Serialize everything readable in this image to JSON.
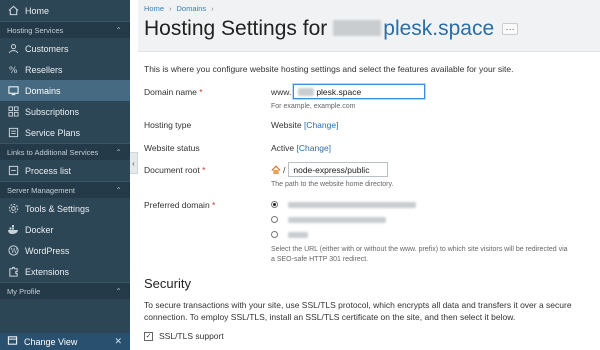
{
  "sidebar": {
    "home": "Home",
    "sections": {
      "hosting": "Hosting Services",
      "links": "Links to Additional Services",
      "server": "Server Management",
      "profile": "My Profile"
    },
    "hosting_items": [
      {
        "label": "Customers",
        "icon": "customers-icon"
      },
      {
        "label": "Resellers",
        "icon": "resellers-icon"
      },
      {
        "label": "Domains",
        "icon": "domains-icon"
      },
      {
        "label": "Subscriptions",
        "icon": "subscriptions-icon"
      },
      {
        "label": "Service Plans",
        "icon": "service-plans-icon"
      }
    ],
    "links_items": [
      {
        "label": "Process list"
      }
    ],
    "server_items": [
      {
        "label": "Tools & Settings"
      },
      {
        "label": "Docker"
      },
      {
        "label": "WordPress"
      },
      {
        "label": "Extensions"
      }
    ],
    "bottom": {
      "label": "Change View"
    }
  },
  "header": {
    "breadcrumb": [
      "Home",
      "Domains"
    ],
    "title_prefix": "Hosting Settings for",
    "title_domain": "plesk.space",
    "more": "···"
  },
  "form": {
    "intro": "This is where you configure website hosting settings and select the features available for your site.",
    "domain_name": {
      "label": "Domain name",
      "prefix": "www.",
      "value": "plesk.space",
      "hint": "For example, example.com"
    },
    "hosting_type": {
      "label": "Hosting type",
      "value": "Website",
      "link": "[Change]"
    },
    "website_status": {
      "label": "Website status",
      "value": "Active",
      "link": "[Change]"
    },
    "document_root": {
      "label": "Document root",
      "sep": "/",
      "value": "node-express/public",
      "hint": "The path to the website home directory."
    },
    "preferred_domain": {
      "label": "Preferred domain",
      "hint": "Select the URL (either with or without the www. prefix) to which site visitors will be redirected via a SEO-safe HTTP 301 redirect."
    }
  },
  "security": {
    "heading": "Security",
    "text": "To secure transactions with your site, use SSL/TLS protocol, which encrypts all data and transfers it over a secure connection. To employ SSL/TLS, install an SSL/TLS certificate on the site, and then select it below.",
    "ssl_label": "SSL/TLS support"
  }
}
